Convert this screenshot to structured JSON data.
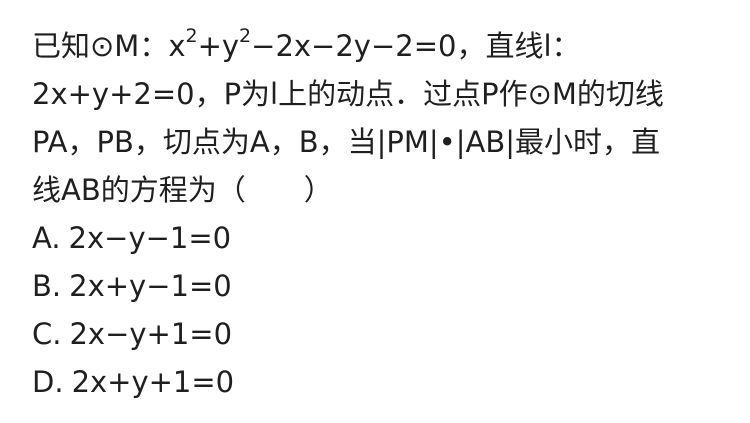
{
  "question": {
    "stem_lines": [
      {
        "pre": "已知⊙M：x",
        "sup1": "2",
        "mid": "+y",
        "sup2": "2",
        "post": "−2x−2y−2=0，直线l："
      },
      {
        "text": "2x+y+2=0，P为l上的动点．过点P作⊙M的切线"
      },
      {
        "text": "PA，PB，切点为A，B，当|PM|•|AB|最小时，直"
      },
      {
        "text": "线AB的方程为（　　）"
      }
    ],
    "options": [
      {
        "letter": "A.",
        "text": "2x−y−1=0"
      },
      {
        "letter": "B.",
        "text": "2x+y−1=0"
      },
      {
        "letter": "C.",
        "text": "2x−y+1=0"
      },
      {
        "letter": "D.",
        "text": "2x+y+1=0"
      }
    ]
  }
}
